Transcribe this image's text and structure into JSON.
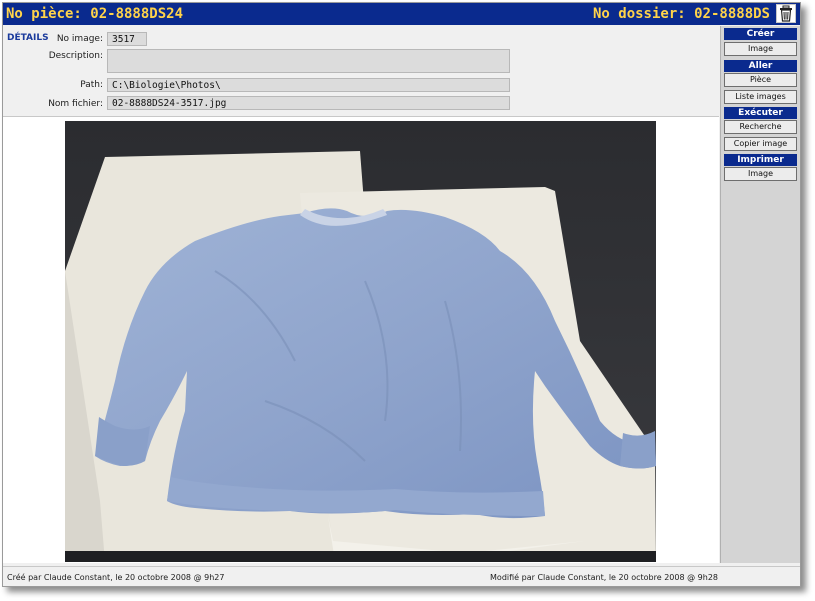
{
  "header": {
    "piece_text": "No pièce: 02-8888DS24",
    "dossier_text": "No dossier: 02-8888DS",
    "trash_icon": "trash-icon"
  },
  "details": {
    "section_label": "DÉTAILS",
    "no_image_label": "No image:",
    "no_image_value": "3517",
    "description_label": "Description:",
    "description_value": "",
    "path_label": "Path:",
    "path_value": "C:\\Biologie\\Photos\\",
    "filename_label": "Nom fichier:",
    "filename_value": "02-8888DS24-3517.jpg"
  },
  "sidebar": {
    "creer": {
      "title": "Créer",
      "buttons": [
        "Image"
      ]
    },
    "aller": {
      "title": "Aller",
      "buttons": [
        "Pièce",
        "Liste images"
      ]
    },
    "executer": {
      "title": "Exécuter",
      "buttons": [
        "Recherche",
        "Copier image"
      ]
    },
    "imprimer": {
      "title": "Imprimer",
      "buttons": [
        "Image"
      ]
    }
  },
  "footer": {
    "created": "Créé par Claude Constant, le 20 octobre 2008 @ 9h27",
    "modified": "Modifié par Claude Constant, le 20 octobre 2008 @ 9h28"
  },
  "colors": {
    "title_bar": "#0a2a8e",
    "title_text": "#ffd34a",
    "section_header": "#0a2a8e"
  }
}
